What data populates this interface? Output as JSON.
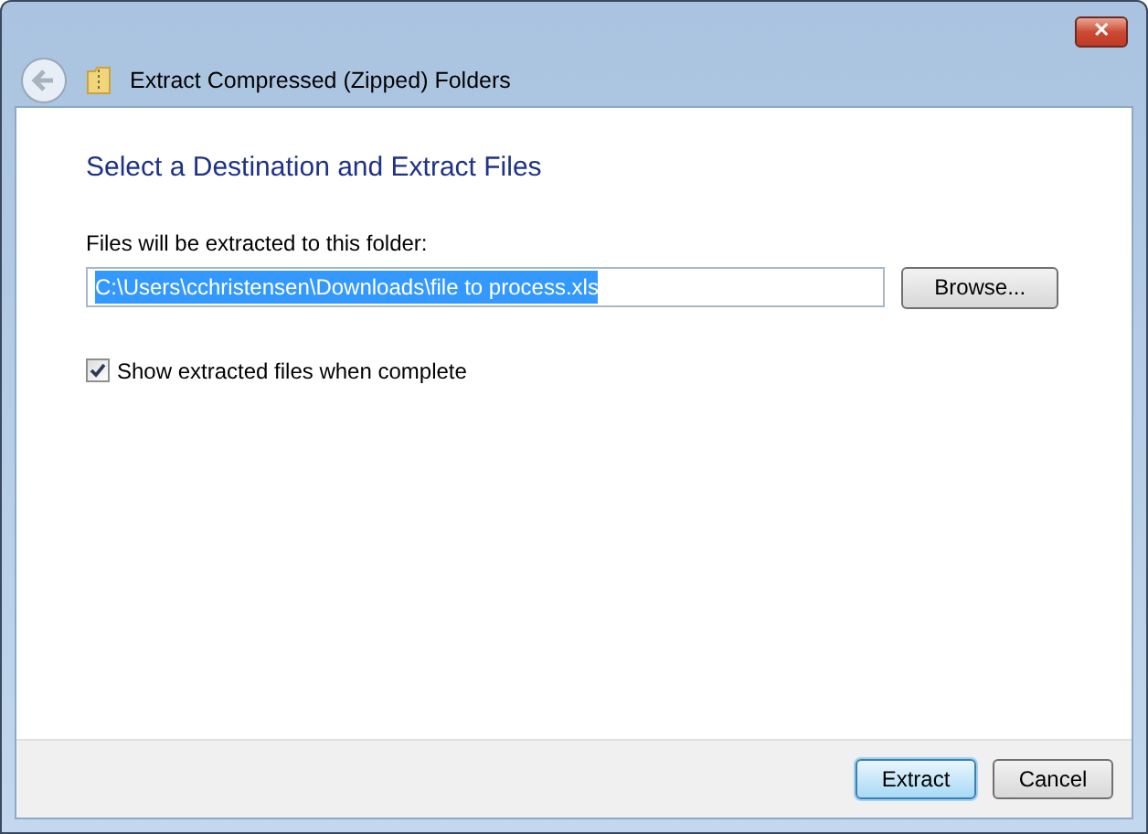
{
  "window": {
    "title": "Extract Compressed (Zipped) Folders",
    "close": "✕"
  },
  "heading": "Select a Destination and Extract Files",
  "destination": {
    "label": "Files will be extracted to this folder:",
    "value": "C:\\Users\\cchristensen\\Downloads\\file to process.xls",
    "text_selected": true
  },
  "browse_button": "Browse...",
  "show_files": {
    "label": "Show extracted files when complete",
    "checked": true
  },
  "buttons": [
    {
      "label": "Extract",
      "default": true
    },
    {
      "label": "Cancel",
      "default": false
    }
  ]
}
